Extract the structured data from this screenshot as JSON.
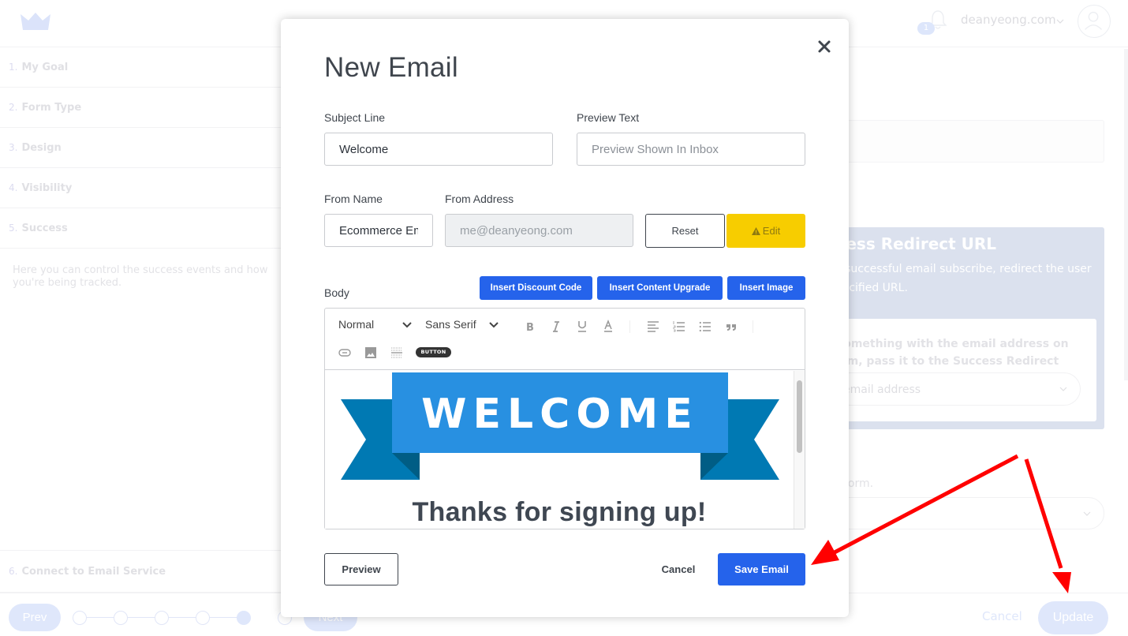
{
  "topbar": {
    "notification_count": "1",
    "site_name": "deanyeong.com"
  },
  "steps": [
    {
      "num": "1.",
      "label": "My Goal"
    },
    {
      "num": "2.",
      "label": "Form Type"
    },
    {
      "num": "3.",
      "label": "Design"
    },
    {
      "num": "4.",
      "label": "Visibility"
    },
    {
      "num": "5.",
      "label": "Success"
    }
  ],
  "step_description": "Here you can control the success events and how you're being tracked.",
  "step6": {
    "num": "6.",
    "label": "Connect to Email Service"
  },
  "wizard_nav": {
    "prev_label": "Prev",
    "next_label": "Next",
    "total_steps": 6,
    "current_step": 5
  },
  "right_panel": {
    "redirect_title": "Success Redirect URL",
    "redirect_desc": "After a successful email subscribe, redirect the user to a specified URL.",
    "redirect_inner_text": "Pass something with the email address on the form, pass it to the Success Redirect URL.",
    "redirect_select_value": "email address",
    "form_note": "this form.",
    "cancel_label": "Cancel",
    "update_label": "Update"
  },
  "modal": {
    "title": "New Email",
    "subject_label": "Subject Line",
    "subject_value": "Welcome",
    "preview_text_label": "Preview Text",
    "preview_text_placeholder": "Preview Shown In Inbox",
    "from_name_label": "From Name",
    "from_name_value": "Ecommerce Email",
    "from_address_label": "From Address",
    "from_address_value": "me@deanyeong.com",
    "reset_label": "Reset",
    "edit_label": "Edit",
    "body_label": "Body",
    "insert_buttons": [
      "Insert Discount Code",
      "Insert Content Upgrade",
      "Insert Image"
    ],
    "toolbar": {
      "heading_select": "Normal",
      "font_select": "Sans Serif",
      "button_label": "BUTTON"
    },
    "content": {
      "banner_text": "WELCOME",
      "heading": "Thanks for signing up!"
    },
    "preview_label": "Preview",
    "cancel_label": "Cancel",
    "save_label": "Save Email"
  },
  "colors": {
    "primary": "#2563eb",
    "warning": "#f7cd00",
    "banner_light": "#2890e1",
    "banner_dark": "#0079b3",
    "annotation": "#ff0000"
  }
}
